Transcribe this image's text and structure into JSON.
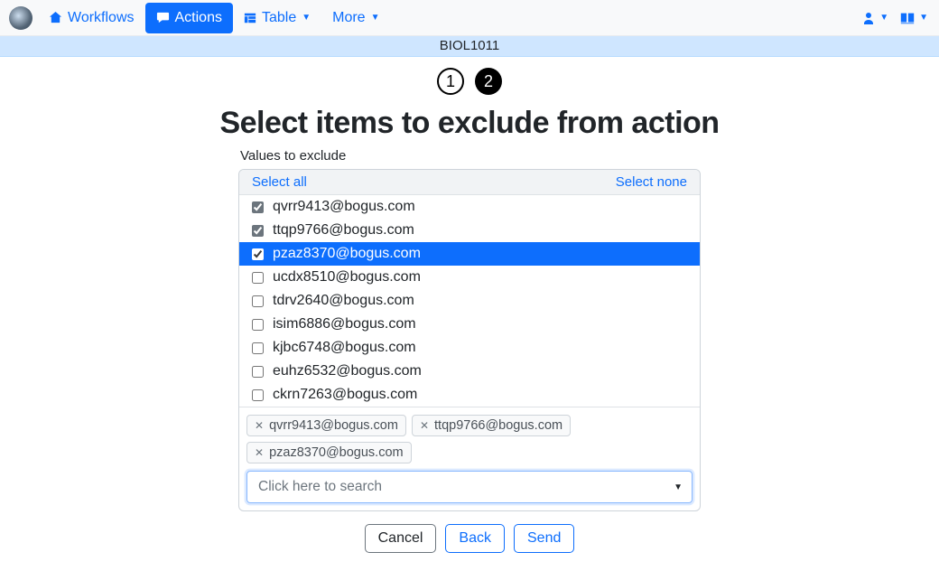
{
  "nav": {
    "workflows": "Workflows",
    "actions": "Actions",
    "table": "Table",
    "more": "More"
  },
  "context": {
    "title": "BIOL1011"
  },
  "steps": {
    "one": "1",
    "two": "2"
  },
  "page": {
    "title": "Select items to exclude from action"
  },
  "panel": {
    "label": "Values to exclude",
    "select_all": "Select all",
    "select_none": "Select none"
  },
  "items": [
    {
      "email": "qvrr9413@bogus.com",
      "checked": true,
      "selected": false
    },
    {
      "email": "ttqp9766@bogus.com",
      "checked": true,
      "selected": false
    },
    {
      "email": "pzaz8370@bogus.com",
      "checked": true,
      "selected": true
    },
    {
      "email": "ucdx8510@bogus.com",
      "checked": false,
      "selected": false
    },
    {
      "email": "tdrv2640@bogus.com",
      "checked": false,
      "selected": false
    },
    {
      "email": "isim6886@bogus.com",
      "checked": false,
      "selected": false
    },
    {
      "email": "kjbc6748@bogus.com",
      "checked": false,
      "selected": false
    },
    {
      "email": "euhz6532@bogus.com",
      "checked": false,
      "selected": false
    },
    {
      "email": "ckrn7263@bogus.com",
      "checked": false,
      "selected": false
    }
  ],
  "chips": [
    "qvrr9413@bogus.com",
    "ttqp9766@bogus.com",
    "pzaz8370@bogus.com"
  ],
  "search": {
    "placeholder": "Click here to search"
  },
  "footer": {
    "cancel": "Cancel",
    "back": "Back",
    "send": "Send"
  }
}
